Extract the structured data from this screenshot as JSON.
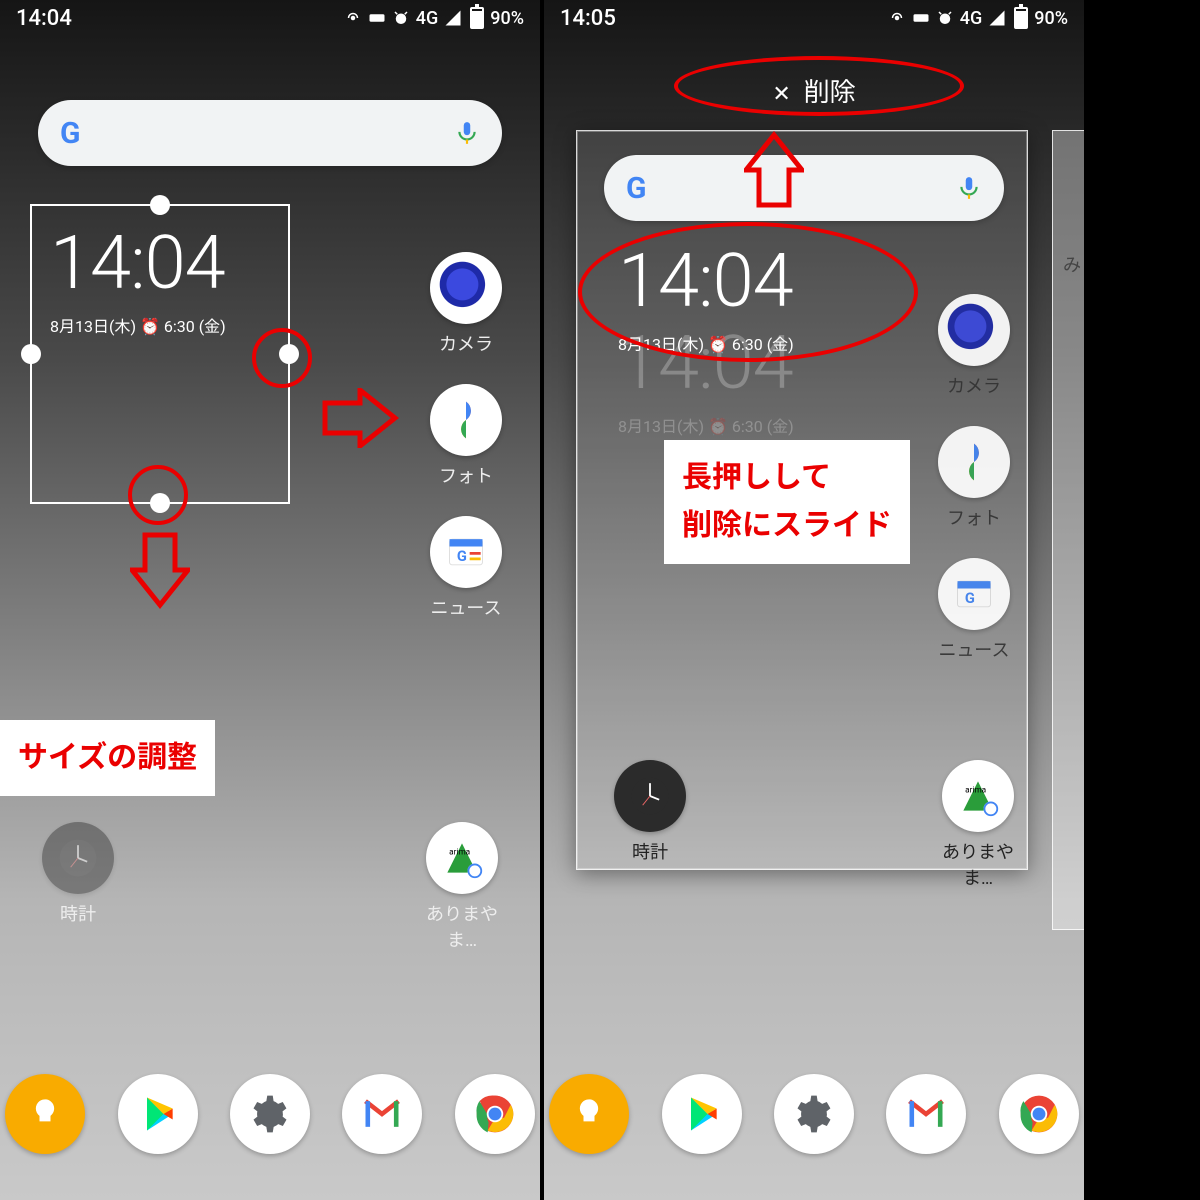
{
  "left": {
    "status": {
      "time": "14:04",
      "net": "4G",
      "battery": "90%"
    },
    "clock": {
      "time": "14:04",
      "date": "8月13日(木) ⏰ 6:30 (金)"
    },
    "apps_right": [
      {
        "id": "camera",
        "label": "カメラ"
      },
      {
        "id": "photos",
        "label": "フォト"
      },
      {
        "id": "news",
        "label": "ニュース"
      }
    ],
    "bottom_apps": [
      {
        "id": "clock",
        "label": "時計"
      },
      {
        "id": "arima",
        "label": "ありまやま…"
      }
    ],
    "annotation": "サイズの調整"
  },
  "right": {
    "status": {
      "time": "14:05",
      "net": "4G",
      "battery": "90%"
    },
    "delete_label": "削除",
    "clock": {
      "time": "14:04",
      "date": "8月13日(木) ⏰ 6:30 (金)"
    },
    "ghost_clock": {
      "time": "14:04",
      "date": "8月13日(木) ⏰ 6:30 (金)"
    },
    "apps_right": [
      {
        "id": "camera",
        "label": "カメラ"
      },
      {
        "id": "photos",
        "label": "フォト"
      },
      {
        "id": "news",
        "label": "ニュース"
      }
    ],
    "bottom_apps": [
      {
        "id": "clock",
        "label": "時計"
      },
      {
        "id": "arima",
        "label": "ありまやま…"
      }
    ],
    "peek_label": "み",
    "annotation": "長押しして\n削除にスライド"
  },
  "dock": [
    "keep",
    "play",
    "settings",
    "gmail",
    "chrome"
  ]
}
